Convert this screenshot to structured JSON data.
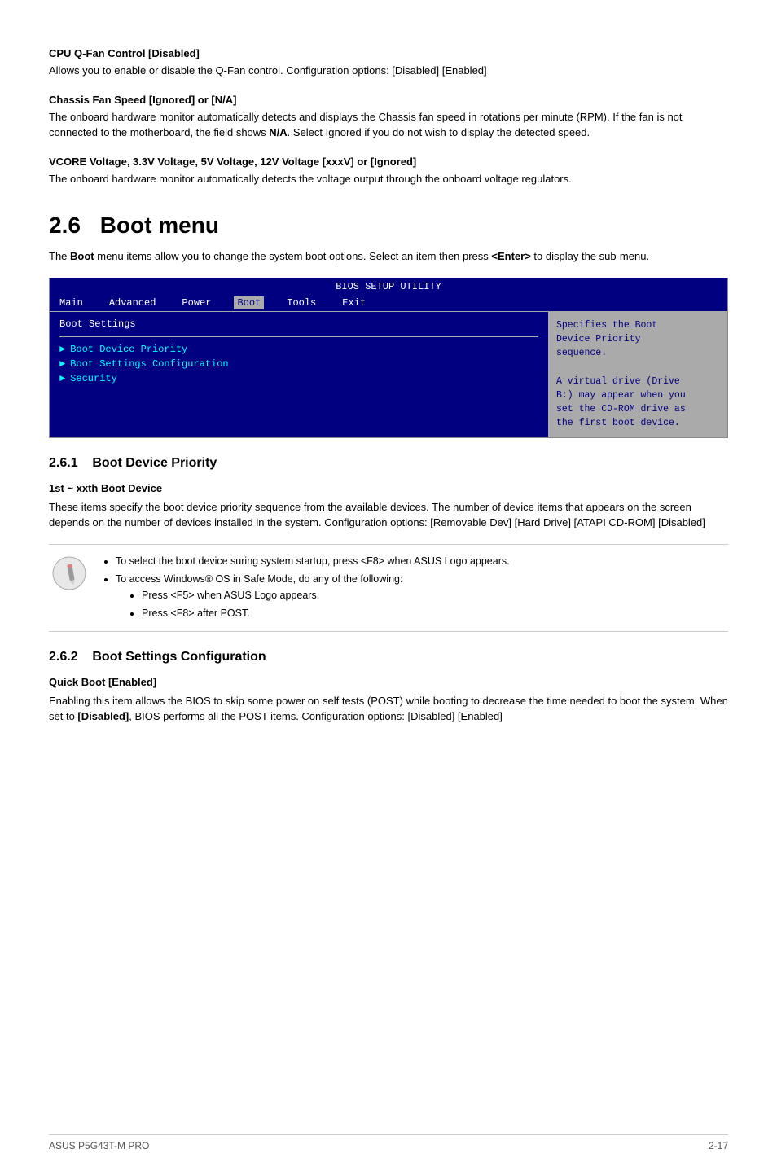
{
  "sections": {
    "cpu_qfan": {
      "heading": "CPU Q-Fan Control [Disabled]",
      "body": "Allows you to enable or disable the Q-Fan control. Configuration options: [Disabled] [Enabled]"
    },
    "chassis_fan": {
      "heading": "Chassis Fan Speed [Ignored] or [N/A]",
      "body_parts": [
        "The onboard hardware monitor automatically detects and displays the Chassis fan speed in rotations per minute (RPM). If the fan is not connected to the motherboard, the field shows ",
        "N/A",
        ". Select Ignored if you do not wish to display the detected speed."
      ]
    },
    "vcore": {
      "heading": "VCORE Voltage, 3.3V Voltage, 5V Voltage, 12V Voltage [xxxV] or [Ignored]",
      "body": "The onboard hardware monitor automatically detects the voltage output through the onboard voltage regulators."
    },
    "boot_menu": {
      "chapter": "2.6",
      "title": "Boot menu",
      "intro_pre": "The ",
      "intro_bold": "Boot",
      "intro_post": " menu items allow you to change the system boot options. Select an item then press ",
      "intro_bold2": "<Enter>",
      "intro_post2": " to display the sub-menu."
    },
    "bios": {
      "title": "BIOS SETUP UTILITY",
      "nav": [
        "Main",
        "Advanced",
        "Power",
        "Boot",
        "Tools",
        "Exit"
      ],
      "active_nav": "Boot",
      "section_label": "Boot Settings",
      "menu_items": [
        "Boot Device Priority",
        "Boot Settings Configuration",
        "Security"
      ],
      "help_text": "Specifies the Boot Device Priority sequence.\n\nA virtual drive (Drive B:) may appear when you set the CD-ROM drive as the first boot device."
    },
    "boot_device_priority": {
      "number": "2.6.1",
      "title": "Boot Device Priority",
      "sub_heading": "1st ~ xxth Boot Device",
      "body": "These items specify the boot device priority sequence from the available devices. The number of device items that appears on the screen depends on the number of devices installed in the system. Configuration options: [Removable Dev] [Hard Drive] [ATAPI CD-ROM] [Disabled]"
    },
    "tips": {
      "tip1": "To select the boot device suring system startup, press <F8> when ASUS Logo appears.",
      "tip2": "To access Windows® OS in Safe Mode, do any of the following:",
      "tip2a": "Press <F5> when ASUS Logo appears.",
      "tip2b": "Press <F8> after POST."
    },
    "boot_settings_config": {
      "number": "2.6.2",
      "title": "Boot Settings Configuration",
      "sub_heading": "Quick Boot [Enabled]",
      "body_pre": "Enabling this item allows the BIOS to skip some power on self tests (POST) while booting to decrease the time needed to boot the system. When set to ",
      "body_bold": "[Disabled]",
      "body_post": ", BIOS performs all the POST items. Configuration options: [Disabled] [Enabled]"
    }
  },
  "footer": {
    "left": "ASUS P5G43T-M PRO",
    "right": "2-17"
  }
}
